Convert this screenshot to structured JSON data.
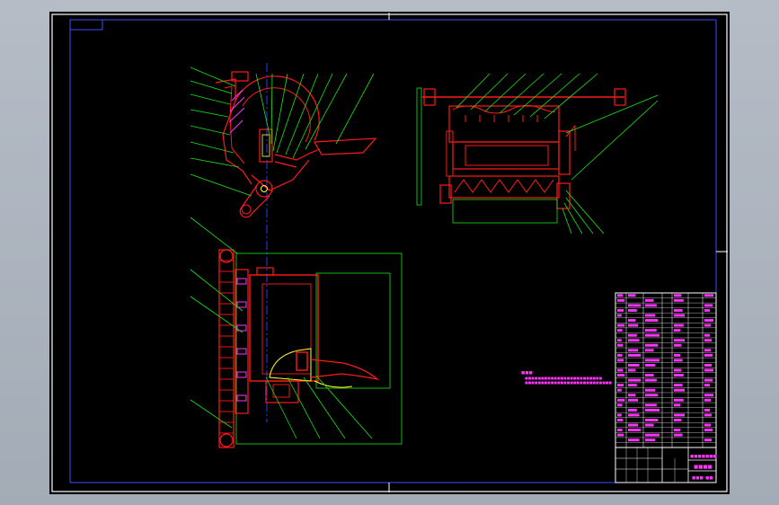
{
  "drawing": {
    "background": "#000000",
    "viewport_bg": "#aab1bb",
    "colors": {
      "border": "#ffffff",
      "frame": "#3a4bff",
      "part": "#ff1a1a",
      "leader": "#19e619",
      "centerline": "#2b3bff",
      "text": "#ff33ff",
      "highlight": "#ffff33"
    }
  },
  "title_block": {
    "title_glyph": "■■■■",
    "drawing_no_glyph": "■■■–■■",
    "unit_glyph": "■■■■■■■"
  },
  "notes": {
    "header_glyph": "■■■:",
    "lines": [
      "■■■■■■■■■■■■■■■■■■■■■■■■",
      "■■■■■■■■■■■■■■■■■■■■■■■■■■■"
    ]
  }
}
